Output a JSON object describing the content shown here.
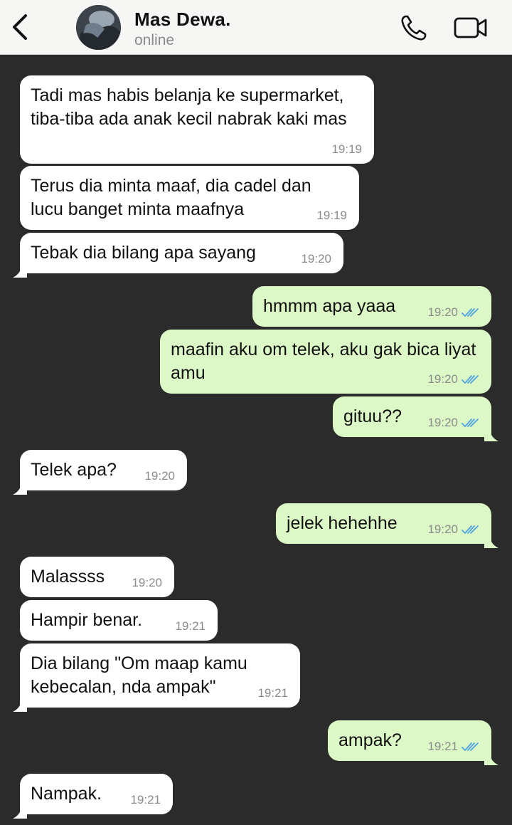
{
  "header": {
    "contact_name": "Mas Dewa.",
    "status": "online",
    "back_icon": "chevron-left-icon",
    "call_icon": "phone-icon",
    "video_icon": "video-camera-icon"
  },
  "colors": {
    "chat_background": "#2b2b2b",
    "incoming_bubble": "#ffffff",
    "outgoing_bubble": "#dcf8c6",
    "read_ticks": "#4fa3e0"
  },
  "messages": [
    {
      "direction": "in",
      "text": "Tadi mas habis belanja ke supermarket, tiba-tiba ada anak kecil nabrak kaki mas",
      "time": "19:19"
    },
    {
      "direction": "in",
      "text": "Terus dia minta maaf, dia cadel dan lucu banget minta maafnya",
      "time": "19:19"
    },
    {
      "direction": "in",
      "text": "Tebak dia bilang apa sayang",
      "time": "19:20"
    },
    {
      "direction": "out",
      "text": "hmmm apa yaaa",
      "time": "19:20",
      "status": "read"
    },
    {
      "direction": "out",
      "text": "maafin aku om telek, aku gak bica liyat amu",
      "time": "19:20",
      "status": "read"
    },
    {
      "direction": "out",
      "text": "gituu??",
      "time": "19:20",
      "status": "read"
    },
    {
      "direction": "in",
      "text": "Telek apa?",
      "time": "19:20"
    },
    {
      "direction": "out",
      "text": "jelek hehehhe",
      "time": "19:20",
      "status": "read"
    },
    {
      "direction": "in",
      "text": "Malassss",
      "time": "19:20"
    },
    {
      "direction": "in",
      "text": "Hampir benar.",
      "time": "19:21"
    },
    {
      "direction": "in",
      "text": "Dia bilang \"Om maap kamu kebecalan, nda ampak\"",
      "time": "19:21"
    },
    {
      "direction": "out",
      "text": "ampak?",
      "time": "19:21",
      "status": "read"
    },
    {
      "direction": "in",
      "text": "Nampak.",
      "time": "19:21"
    }
  ]
}
